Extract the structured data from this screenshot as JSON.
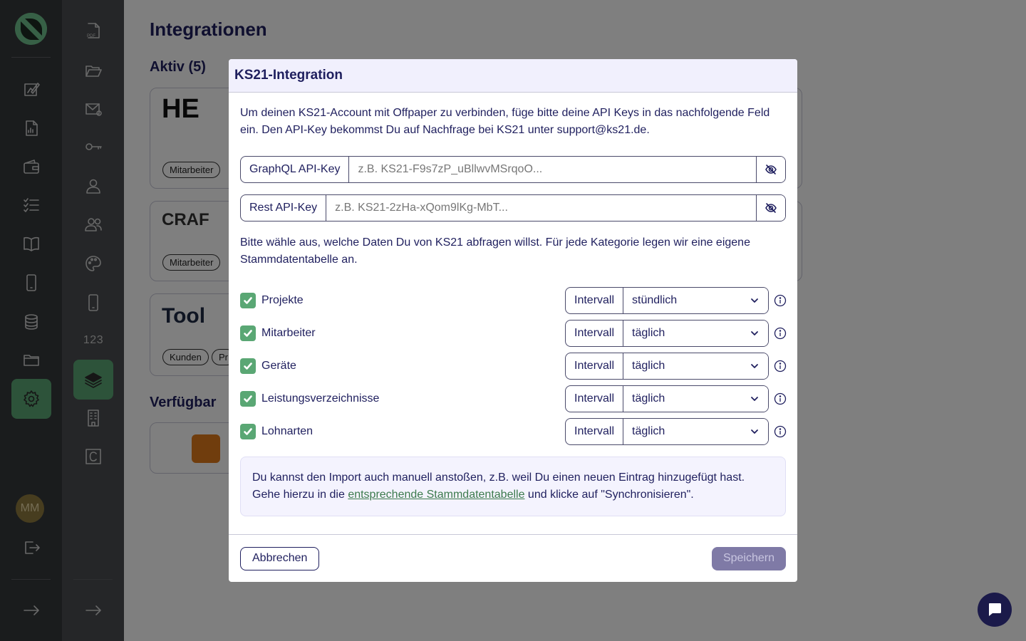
{
  "page": {
    "title": "Integrationen",
    "active_section": "Aktiv (5)",
    "available_section": "Verfügbar"
  },
  "cards": [
    {
      "brand": "HE",
      "tags": [
        "Mitarbeiter"
      ]
    },
    {
      "brand": "CRAF",
      "tags": [
        "Mitarbeiter"
      ]
    },
    {
      "brand": "Tool",
      "tags": [
        "Kunden",
        "Pr"
      ]
    }
  ],
  "sidebar": {
    "avatar_initials": "MM",
    "numbers_label": "123",
    "pdf_label": "PDF"
  },
  "modal": {
    "title": "KS21-Integration",
    "intro": "Um deinen KS21-Account mit Offpaper zu verbinden, füge bitte deine API Keys in das nachfolgende Feld ein. Den API-Key bekommst Du auf Nachfrage bei KS21 unter support@ks21.de.",
    "graphql": {
      "label": "GraphQL API-Key",
      "placeholder": "z.B. KS21-F9s7zP_uBllwvMSrqoO..."
    },
    "rest": {
      "label": "Rest API-Key",
      "placeholder": "z.B. KS21-2zHa-xQom9lKg-MbT..."
    },
    "choose_text": "Bitte wähle aus, welche Daten Du von KS21 abfragen willst. Für jede Kategorie legen wir eine eigene Stammdatentabelle an.",
    "interval_label": "Intervall",
    "categories": [
      {
        "label": "Projekte",
        "checked": true,
        "interval": "stündlich"
      },
      {
        "label": "Mitarbeiter",
        "checked": true,
        "interval": "täglich"
      },
      {
        "label": "Geräte",
        "checked": true,
        "interval": "täglich"
      },
      {
        "label": "Leistungsverzeichnisse",
        "checked": true,
        "interval": "täglich"
      },
      {
        "label": "Lohnarten",
        "checked": true,
        "interval": "täglich"
      }
    ],
    "note": {
      "line1": "Du kannst den Import auch manuell anstoßen, z.B. weil Du einen neuen Eintrag hinzugefügt hast.",
      "line2_prefix": "Gehe hierzu in die ",
      "link": "entsprechende Stammdatentabelle",
      "line2_suffix": " und klicke auf \"Synchronisieren\"."
    },
    "cancel_label": "Abbrechen",
    "save_label": "Speichern"
  },
  "colors": {
    "accent_green": "#5aa774",
    "navy": "#1f1f5e",
    "save_disabled": "#7f7aa6"
  }
}
